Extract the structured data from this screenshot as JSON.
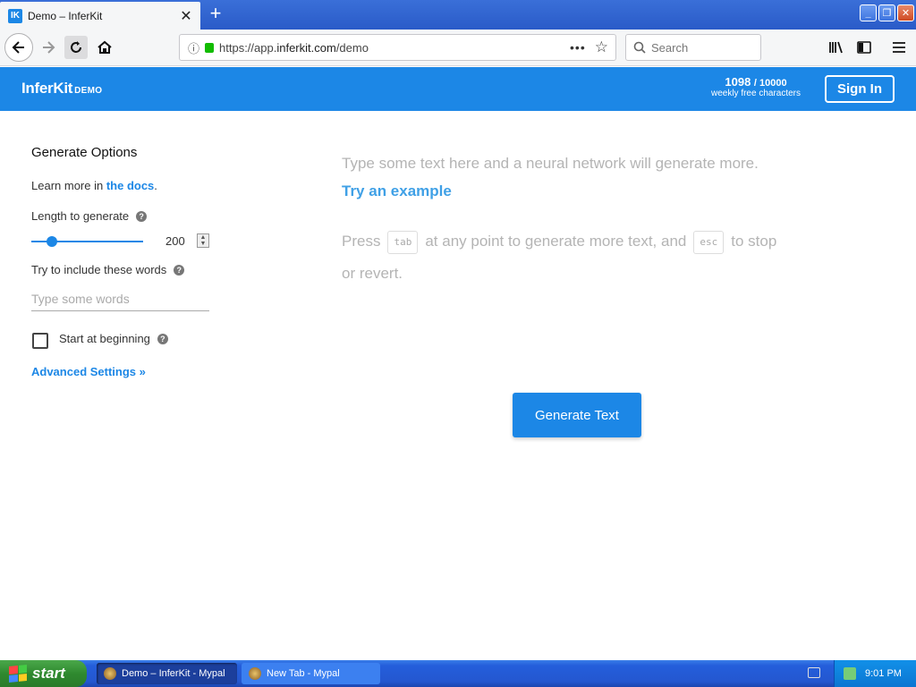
{
  "browser": {
    "tab_title": "Demo – InferKit",
    "tab_favicon": "IK",
    "url_prefix": "https://app.",
    "url_domain": "inferkit.com",
    "url_path": "/demo",
    "search_placeholder": "Search"
  },
  "header": {
    "brand": "InferKit",
    "brand_tag": "DEMO",
    "chars_used": "1098",
    "chars_total": "/ 10000",
    "chars_caption": "weekly free characters",
    "signin_label": "Sign In"
  },
  "options": {
    "title": "Generate Options",
    "learn_prefix": "Learn more in ",
    "learn_link": "the docs",
    "learn_suffix": ".",
    "length_label": "Length to generate",
    "length_value": "200",
    "length_fraction": 0.1,
    "words_label": "Try to include these words",
    "words_placeholder": "Type some words",
    "start_label": "Start at beginning",
    "start_checked": false,
    "advanced_label": "Advanced Settings »"
  },
  "editor": {
    "placeholder": "Type some text here and a neural network will generate more.",
    "try_example": "Try an example",
    "hint_press": "Press",
    "hint_key_tab": "tab",
    "hint_middle": "at any point to generate more text, and",
    "hint_key_esc": "esc",
    "hint_end": "to stop or revert.",
    "generate_label": "Generate Text"
  },
  "taskbar": {
    "start_label": "start",
    "tasks": [
      {
        "label": "Demo – InferKit - Mypal",
        "active": true
      },
      {
        "label": "New Tab - Mypal",
        "active": false
      }
    ],
    "clock": "9:01 PM"
  },
  "colors": {
    "brand_blue": "#1c87e6",
    "link_blue": "#3fa0e6",
    "placeholder_gray": "#b4b4b4"
  }
}
